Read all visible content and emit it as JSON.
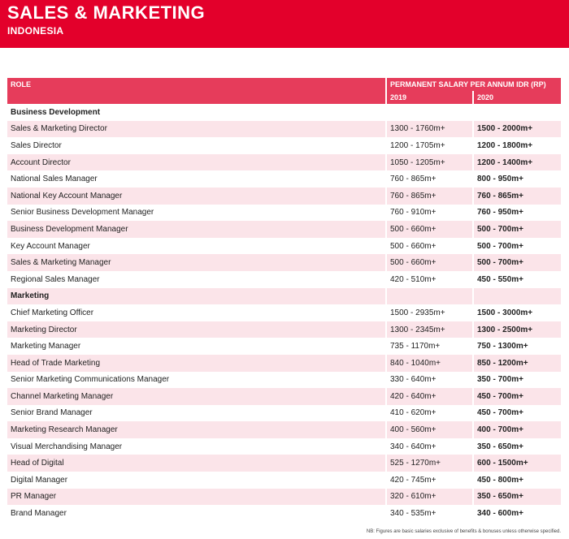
{
  "header": {
    "title": "SALES & MARKETING",
    "subtitle": "INDONESIA"
  },
  "table": {
    "role_header": "ROLE",
    "salary_header": "PERMANENT SALARY PER ANNUM IDR (RP)",
    "year_2019": "2019",
    "year_2020": "2020",
    "sections": [
      {
        "category": "Business Development",
        "rows": [
          {
            "role": "Sales & Marketing Director",
            "y2019": "1300 - 1760m+",
            "y2020": "1500 - 2000m+"
          },
          {
            "role": "Sales Director",
            "y2019": "1200 - 1705m+",
            "y2020": "1200 - 1800m+"
          },
          {
            "role": "Account Director",
            "y2019": "1050 - 1205m+",
            "y2020": "1200 - 1400m+"
          },
          {
            "role": "National Sales Manager",
            "y2019": "760 - 865m+",
            "y2020": "800 - 950m+"
          },
          {
            "role": "National Key Account Manager",
            "y2019": "760 - 865m+",
            "y2020": "760 - 865m+"
          },
          {
            "role": "Senior Business Development Manager",
            "y2019": "760 - 910m+",
            "y2020": "760 - 950m+"
          },
          {
            "role": "Business Development Manager",
            "y2019": "500 - 660m+",
            "y2020": "500 - 700m+"
          },
          {
            "role": "Key Account Manager",
            "y2019": "500 - 660m+",
            "y2020": "500 - 700m+"
          },
          {
            "role": "Sales & Marketing Manager",
            "y2019": "500 - 660m+",
            "y2020": "500 - 700m+"
          },
          {
            "role": "Regional Sales Manager",
            "y2019": "420 - 510m+",
            "y2020": "450 - 550m+"
          }
        ]
      },
      {
        "category": "Marketing",
        "rows": [
          {
            "role": "Chief Marketing Officer",
            "y2019": "1500 - 2935m+",
            "y2020": "1500 - 3000m+"
          },
          {
            "role": "Marketing Director",
            "y2019": "1300 - 2345m+",
            "y2020": "1300 - 2500m+"
          },
          {
            "role": "Marketing Manager",
            "y2019": "735 - 1170m+",
            "y2020": "750 - 1300m+"
          },
          {
            "role": "Head of Trade Marketing",
            "y2019": "840 - 1040m+",
            "y2020": "850 - 1200m+"
          },
          {
            "role": "Senior Marketing Communications Manager",
            "y2019": "330 - 640m+",
            "y2020": "350 - 700m+"
          },
          {
            "role": "Channel Marketing Manager",
            "y2019": "420 - 640m+",
            "y2020": "450 - 700m+"
          },
          {
            "role": "Senior Brand Manager",
            "y2019": "410 - 620m+",
            "y2020": "450 - 700m+"
          },
          {
            "role": "Marketing Research Manager",
            "y2019": "400 - 560m+",
            "y2020": "400 - 700m+"
          },
          {
            "role": "Visual Merchandising Manager",
            "y2019": "340 - 640m+",
            "y2020": "350 - 650m+"
          },
          {
            "role": "Head of Digital",
            "y2019": "525 - 1270m+",
            "y2020": "600 - 1500m+"
          },
          {
            "role": "Digital Manager",
            "y2019": "420 - 745m+",
            "y2020": "450 - 800m+"
          },
          {
            "role": "PR Manager",
            "y2019": "320 - 610m+",
            "y2020": "350 - 650m+"
          },
          {
            "role": "Brand Manager",
            "y2019": "340 - 535m+",
            "y2020": "340 - 600m+"
          }
        ]
      }
    ]
  },
  "footnote": "NB: Figures are basic salaries exclusive of benefits & bonuses unless otherwise specified.",
  "colors": {
    "banner": "#e3002b",
    "header_row": "#e63c5b",
    "shaded_row": "#fbe4e9"
  }
}
